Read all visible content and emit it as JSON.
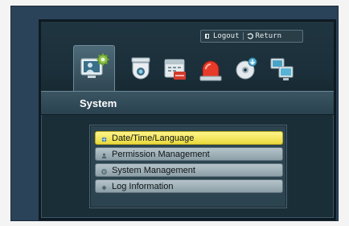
{
  "topbar": {
    "logout_label": "Logout",
    "return_label": "Return"
  },
  "icon_tabs": [
    {
      "name": "system-icon",
      "active": true
    },
    {
      "name": "camera-icon",
      "active": false
    },
    {
      "name": "record-icon",
      "active": false
    },
    {
      "name": "event-icon",
      "active": false
    },
    {
      "name": "backup-icon",
      "active": false
    },
    {
      "name": "network-icon",
      "active": false
    }
  ],
  "banner": {
    "title": "System"
  },
  "menu": {
    "items": [
      {
        "label": "Date/Time/Language",
        "icon": "globe-icon",
        "selected": true
      },
      {
        "label": "Permission Management",
        "icon": "user-icon",
        "selected": false
      },
      {
        "label": "System Management",
        "icon": "gear-icon",
        "selected": false
      },
      {
        "label": "Log Information",
        "icon": "log-icon",
        "selected": false
      }
    ]
  },
  "colors": {
    "highlight": "#f5e560",
    "background": "#1a2e38",
    "item": "#a2b3ba"
  }
}
